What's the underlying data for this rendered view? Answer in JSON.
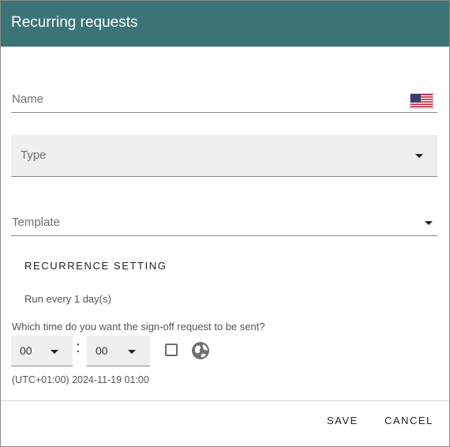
{
  "dialog": {
    "title": "Recurring requests"
  },
  "name_field": {
    "label": "Name",
    "flag_icon": "us-flag-icon"
  },
  "type_field": {
    "label": "Type"
  },
  "template_field": {
    "label": "Template"
  },
  "recurrence": {
    "section_title": "RECURRENCE SETTING",
    "run_every_text": "Run every 1 day(s)",
    "time_question": "Which time do you want the sign-off request to be sent?",
    "hour_value": "00",
    "minute_value": "00",
    "separator": ":",
    "timezone_text": "(UTC+01:00) 2024-11-19 01:00"
  },
  "footer": {
    "save_label": "SAVE",
    "cancel_label": "CANCEL"
  },
  "colors": {
    "header_background": "#3a7474",
    "header_text": "#ffffff",
    "filled_field_background": "#efefef"
  }
}
